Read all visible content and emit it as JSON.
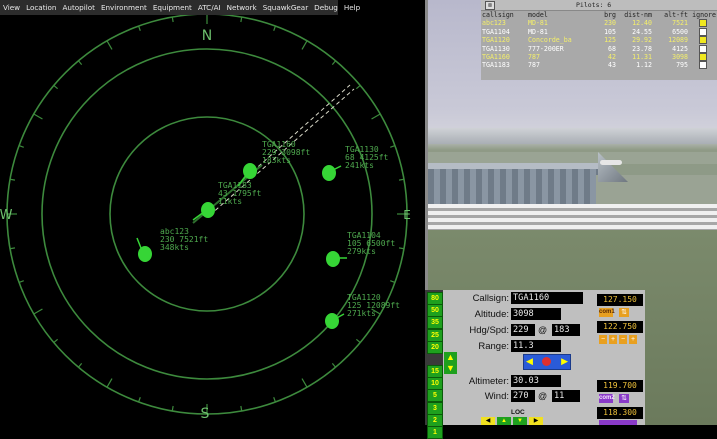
{
  "menu": [
    "View",
    "Location",
    "Autopilot",
    "Environment",
    "Equipment",
    "ATC/AI",
    "Network",
    "SquawkGear",
    "Debug",
    "Help"
  ],
  "radar": {
    "compass": {
      "n": "N",
      "e": "E",
      "s": "S",
      "w": "W"
    },
    "targets": [
      {
        "id": "TGA1160",
        "label": [
          "TGA1160",
          "229 3098ft",
          "183kts"
        ]
      },
      {
        "id": "TGA1183",
        "label": [
          "TGA1183",
          "43 1795ft",
          "11kts"
        ]
      },
      {
        "id": "abc123",
        "label": [
          "abc123",
          "230 7521ft",
          "348kts"
        ]
      },
      {
        "id": "TGA1130",
        "label": [
          "TGA1130",
          "68 4125ft",
          "241kts"
        ]
      },
      {
        "id": "TGA1104",
        "label": [
          "TGA1104",
          "105 6500ft",
          "279kts"
        ]
      },
      {
        "id": "TGA1120",
        "label": [
          "TGA1120",
          "125 12089ft",
          "271kts"
        ]
      }
    ]
  },
  "pilots": {
    "close": "⊠",
    "count_label": "Pilots: 6",
    "headers": [
      "callsign",
      "model",
      "brg",
      "dist-nm",
      "alt-ft",
      "ignore"
    ],
    "rows": [
      {
        "callsign": "abc123",
        "model": "MD-81",
        "brg": "230",
        "dist": "12.40",
        "alt": "7521",
        "highlight": true
      },
      {
        "callsign": "TGA1104",
        "model": "MD-81",
        "brg": "105",
        "dist": "24.55",
        "alt": "6500",
        "highlight": false
      },
      {
        "callsign": "TGA1120",
        "model": "Concorde_ba",
        "brg": "125",
        "dist": "29.92",
        "alt": "12089",
        "highlight": true
      },
      {
        "callsign": "TGA1130",
        "model": "777-200ER",
        "brg": "68",
        "dist": "23.78",
        "alt": "4125",
        "highlight": false
      },
      {
        "callsign": "TGA1160",
        "model": "787",
        "brg": "42",
        "dist": "11.31",
        "alt": "3098",
        "highlight": true
      },
      {
        "callsign": "TGA1183",
        "model": "787",
        "brg": "43",
        "dist": "1.12",
        "alt": "795",
        "highlight": false
      }
    ]
  },
  "atc": {
    "alt_buttons": [
      "80",
      "50",
      "35",
      "25",
      "20",
      "15",
      "10",
      "5",
      "3",
      "2",
      "1"
    ],
    "callsign_label": "Callsign:",
    "callsign": "TGA1160",
    "altitude_label": "Altitude:",
    "altitude": "3098",
    "hdgspd_label": "Hdg/Spd:",
    "hdg": "229",
    "spd": "183",
    "at": "@",
    "range_label": "Range:",
    "range": "11.3",
    "altimeter_label": "Altimeter:",
    "altimeter": "30.03",
    "wind_label": "Wind:",
    "wind_dir": "270",
    "wind_spd": "11",
    "loc_label": "LOC",
    "com1_a": "127.150",
    "com1_b": "122.750",
    "com1_label": "com1",
    "com2_a": "119.700",
    "com2_b": "118.300",
    "com2_label": "com2"
  },
  "colors": {
    "radar": "#3d8a3d",
    "blip": "#36d536",
    "label": "#3aa03a"
  }
}
